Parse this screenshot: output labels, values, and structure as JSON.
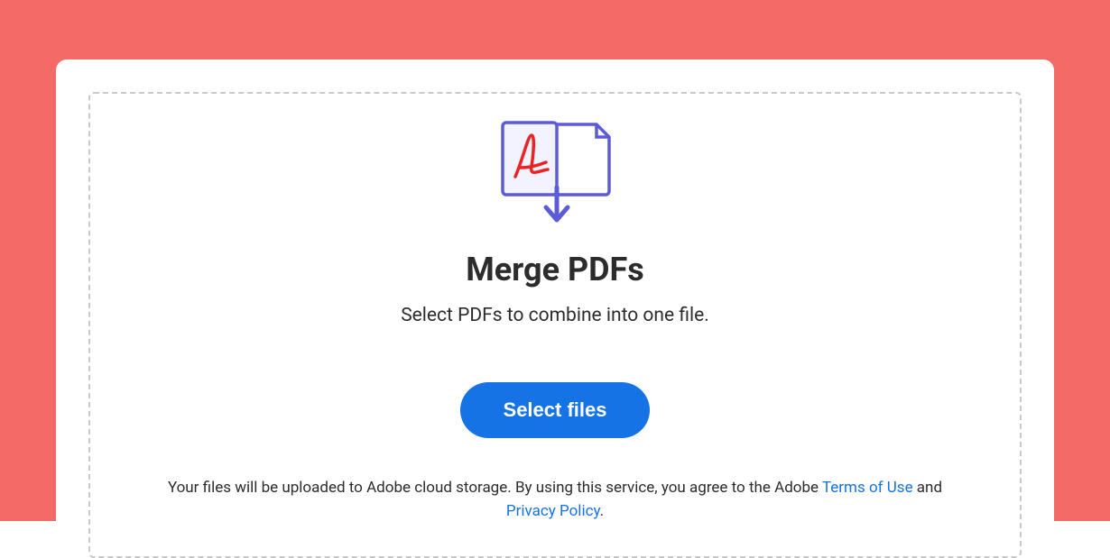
{
  "title": "Merge PDFs",
  "subtitle": "Select PDFs to combine into one file.",
  "select_button": "Select files",
  "legal": {
    "pre": "Your files will be uploaded to Adobe cloud storage.  By using this service, you agree to the Adobe ",
    "terms": "Terms of Use",
    "mid": " and ",
    "privacy": "Privacy Policy",
    "post": "."
  },
  "icons": {
    "merge_pdf": "merge-pdf-icon"
  },
  "colors": {
    "background": "#f36a66",
    "button": "#1573e6",
    "link": "#1573e6",
    "icon_outline": "#5c5cd6",
    "icon_accent": "#ed2224"
  }
}
